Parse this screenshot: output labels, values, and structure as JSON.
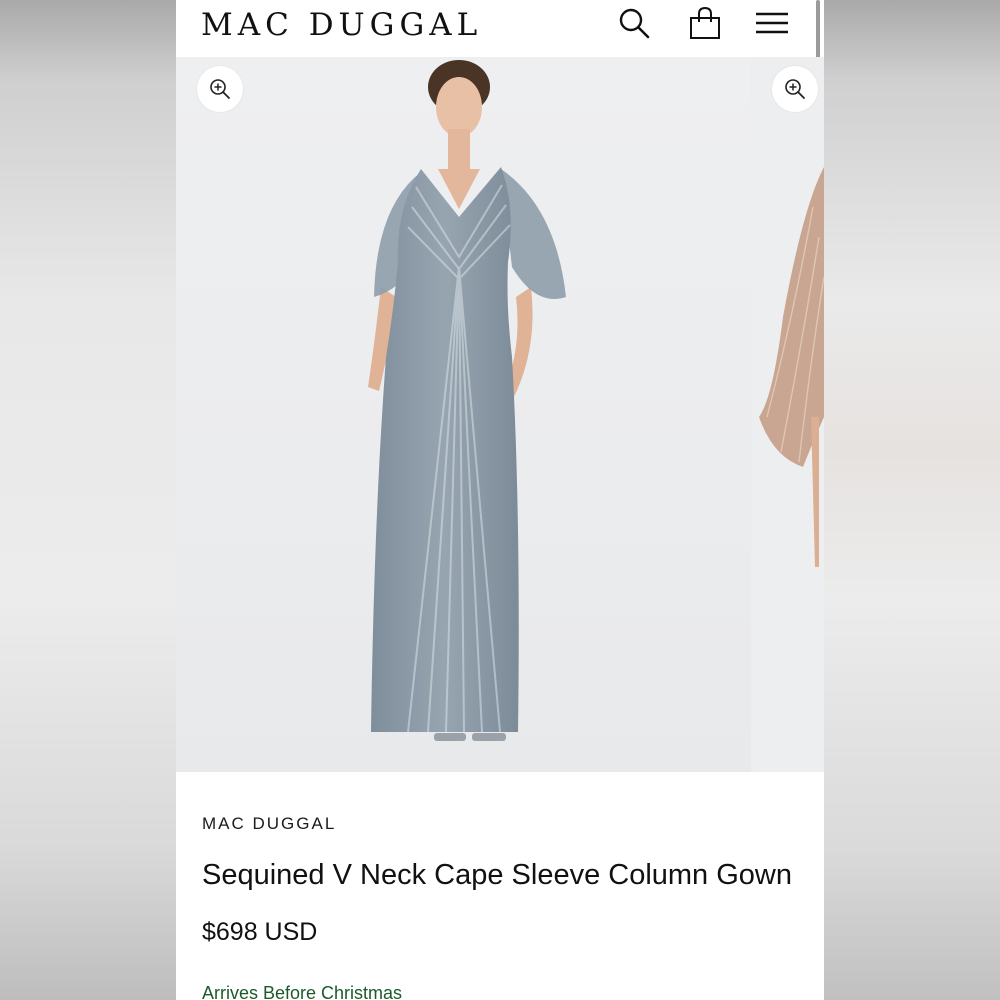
{
  "header": {
    "brand": "MAC DUGGAL",
    "icons": {
      "search": "search-icon",
      "bag": "shopping-bag-icon",
      "menu": "hamburger-menu-icon"
    }
  },
  "gallery": {
    "zoom_icon": "zoom-in-icon",
    "slides": [
      {
        "subject": "gown-photo",
        "gown_color": "#8c9aa6"
      },
      {
        "subject": "next-gown-photo",
        "gown_color": "#c9a692"
      }
    ]
  },
  "product": {
    "brand": "MAC DUGGAL",
    "title": "Sequined V Neck Cape Sleeve Column Gown",
    "price": "$698 USD",
    "shipping_note": "Arrives Before Christmas"
  },
  "colors": {
    "accent_green": "#1c5a2a",
    "text": "#111111"
  }
}
